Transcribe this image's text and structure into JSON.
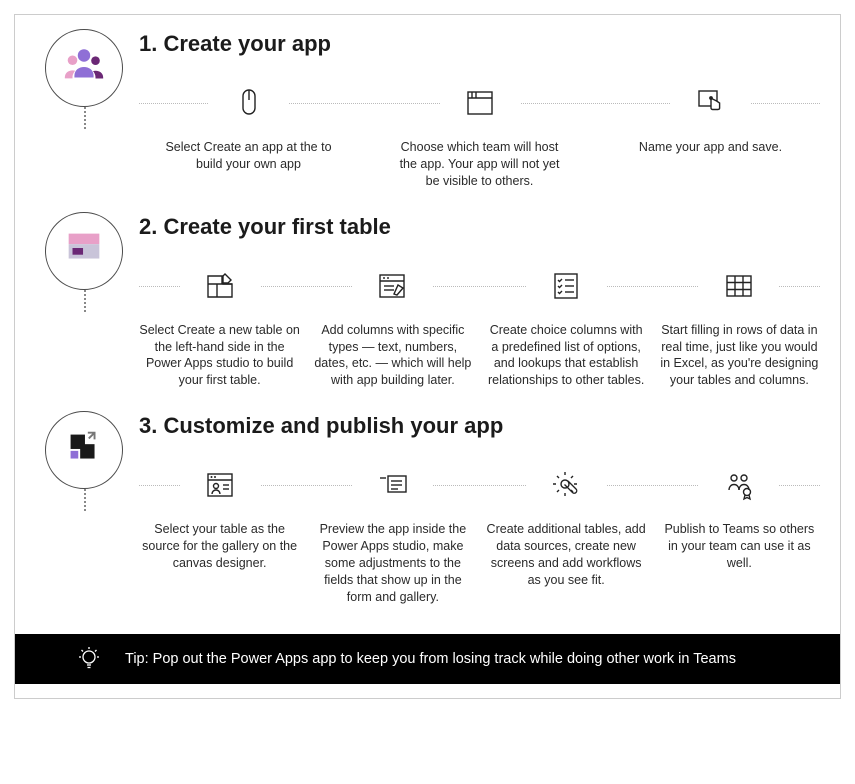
{
  "sections": [
    {
      "title": "1. Create your app",
      "badge_icon": "people-icon",
      "items": [
        {
          "icon": "mouse-icon",
          "text": "Select Create an app at the to build your own app"
        },
        {
          "icon": "app-window-icon",
          "text": "Choose which team will host the app. Your app will not yet be visible to others."
        },
        {
          "icon": "tap-icon",
          "text": "Name your app and save."
        }
      ]
    },
    {
      "title": "2. Create your first table",
      "badge_icon": "table-card-icon",
      "items": [
        {
          "icon": "layout-edit-icon",
          "text": "Select Create a new table on the left-hand side in the Power Apps studio to build your first table."
        },
        {
          "icon": "form-edit-icon",
          "text": "Add columns with specific types — text, numbers, dates, etc. — which will help with app building later."
        },
        {
          "icon": "checklist-icon",
          "text": "Create choice columns with a predefined list of options, and lookups that establish relationships to other tables."
        },
        {
          "icon": "grid-icon",
          "text": "Start filling in rows of data in real time, just like you would in Excel, as you're designing your tables and columns."
        }
      ]
    },
    {
      "title": "3. Customize and publish your app",
      "badge_icon": "squares-icon",
      "items": [
        {
          "icon": "user-window-icon",
          "text": "Select your table as the source for the gallery on the canvas designer."
        },
        {
          "icon": "detail-lines-icon",
          "text": "Preview the app inside the Power Apps studio, make some adjustments to the fields that show up in the form and gallery."
        },
        {
          "icon": "gear-wrench-icon",
          "text": "Create additional tables, add data sources, create new screens and add workflows as you see fit."
        },
        {
          "icon": "people-ribbon-icon",
          "text": "Publish to Teams so others in your team can use it as well."
        }
      ]
    }
  ],
  "tip": {
    "icon": "lightbulb-icon",
    "text": "Tip: Pop out the Power Apps app to keep you from losing track while doing other work in Teams"
  }
}
